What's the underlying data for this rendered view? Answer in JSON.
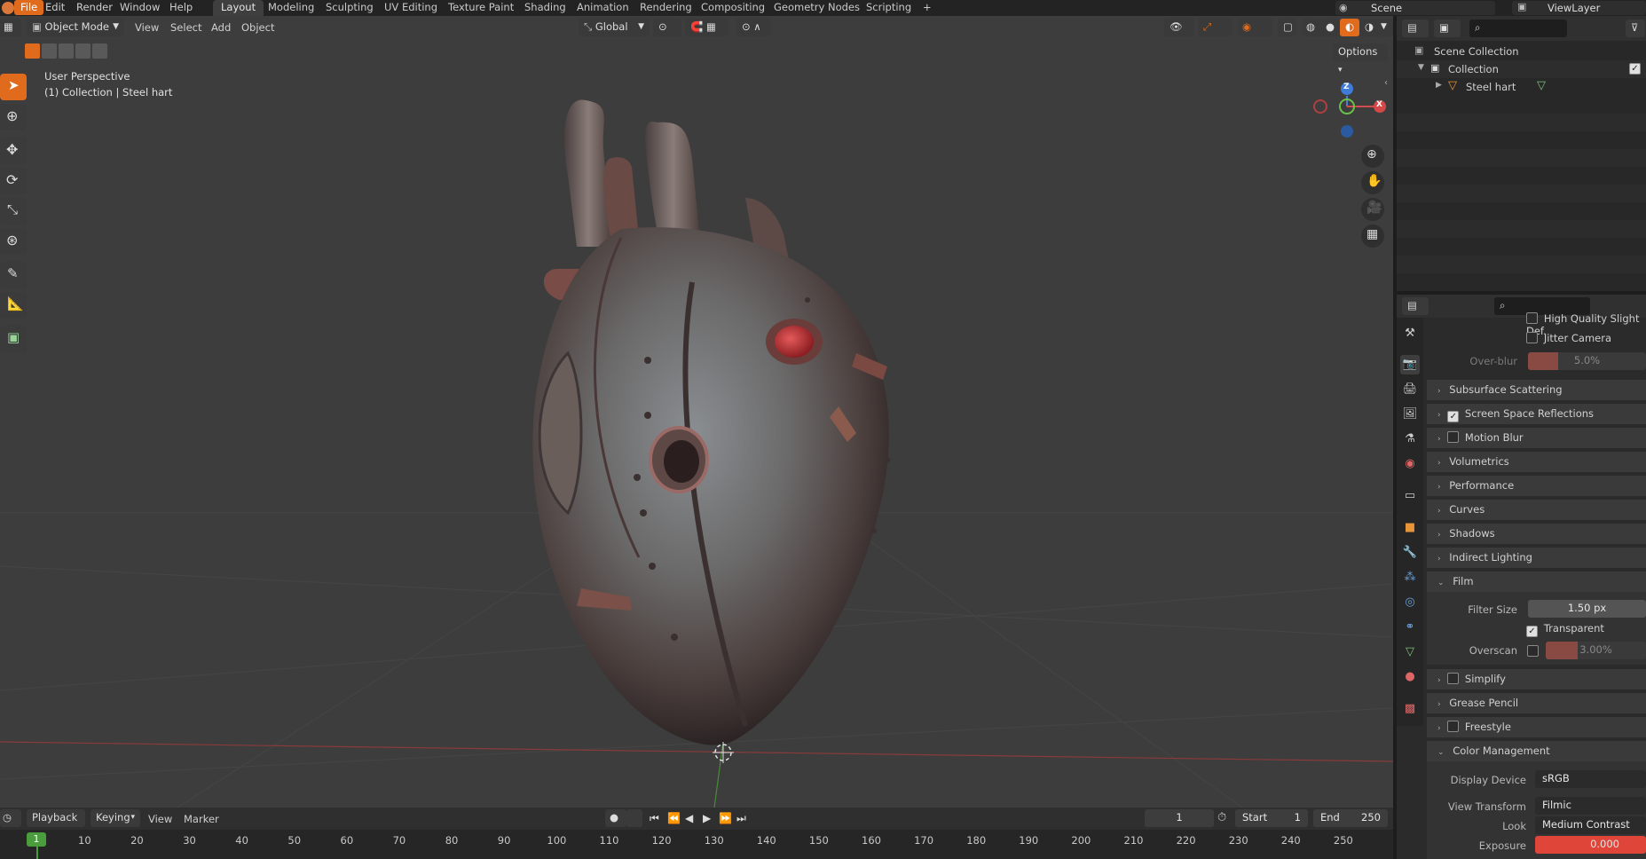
{
  "topbar": {
    "menus": [
      "File",
      "Edit",
      "Render",
      "Window",
      "Help"
    ],
    "workspaces": [
      "Layout",
      "Modeling",
      "Sculpting",
      "UV Editing",
      "Texture Paint",
      "Shading",
      "Animation",
      "Rendering",
      "Compositing",
      "Geometry Nodes",
      "Scripting"
    ],
    "active_workspace": "Layout",
    "add_tab": "+",
    "scene": "Scene",
    "view_layer": "ViewLayer"
  },
  "viewport_header": {
    "mode": "Object Mode",
    "menus": [
      "View",
      "Select",
      "Add",
      "Object"
    ],
    "transform_orientation": "Global",
    "options": "Options"
  },
  "viewport": {
    "perspective": "User Perspective",
    "collection_info": "(1) Collection | Steel hart",
    "gizmo": {
      "z": "Z",
      "x": "X"
    }
  },
  "outliner": {
    "scene_collection": "Scene Collection",
    "collection": "Collection",
    "object": "Steel hart"
  },
  "properties": {
    "high_quality": "High Quality Slight Def.",
    "jitter_camera": "Jitter Camera",
    "overblur_label": "Over-blur",
    "overblur_value": "5.0%",
    "sections": [
      {
        "label": "Subsurface Scattering",
        "checkbox": false,
        "has_cb": false
      },
      {
        "label": "Screen Space Reflections",
        "checkbox": true,
        "has_cb": true
      },
      {
        "label": "Motion Blur",
        "checkbox": false,
        "has_cb": true
      },
      {
        "label": "Volumetrics",
        "has_cb": false
      },
      {
        "label": "Performance",
        "has_cb": false
      },
      {
        "label": "Curves",
        "has_cb": false
      },
      {
        "label": "Shadows",
        "has_cb": false
      },
      {
        "label": "Indirect Lighting",
        "has_cb": false
      }
    ],
    "film": {
      "label": "Film",
      "filter_size_label": "Filter Size",
      "filter_size": "1.50 px",
      "transparent": "Transparent",
      "overscan_label": "Overscan",
      "overscan_value": "3.00%"
    },
    "sections2": [
      {
        "label": "Simplify",
        "has_cb": true
      },
      {
        "label": "Grease Pencil",
        "has_cb": false
      },
      {
        "label": "Freestyle",
        "has_cb": true
      }
    ],
    "color_management": {
      "label": "Color Management",
      "display_device_label": "Display Device",
      "display_device": "sRGB",
      "view_transform_label": "View Transform",
      "view_transform": "Filmic",
      "look_label": "Look",
      "look": "Medium Contrast",
      "exposure_label": "Exposure",
      "exposure": "0.000"
    }
  },
  "timeline": {
    "menus": [
      "Playback",
      "Keying",
      "View",
      "Marker"
    ],
    "current_frame": "1",
    "start_label": "Start",
    "start": "1",
    "end_label": "End",
    "end": "250",
    "ticks": [
      "1",
      "10",
      "20",
      "30",
      "40",
      "50",
      "60",
      "70",
      "80",
      "90",
      "100",
      "110",
      "120",
      "130",
      "140",
      "150",
      "160",
      "170",
      "180",
      "190",
      "200",
      "210",
      "220",
      "230",
      "240",
      "250"
    ]
  },
  "colors": {
    "accent": "#e06b1c",
    "bg": "#303030",
    "panel": "#2b2b2b"
  }
}
